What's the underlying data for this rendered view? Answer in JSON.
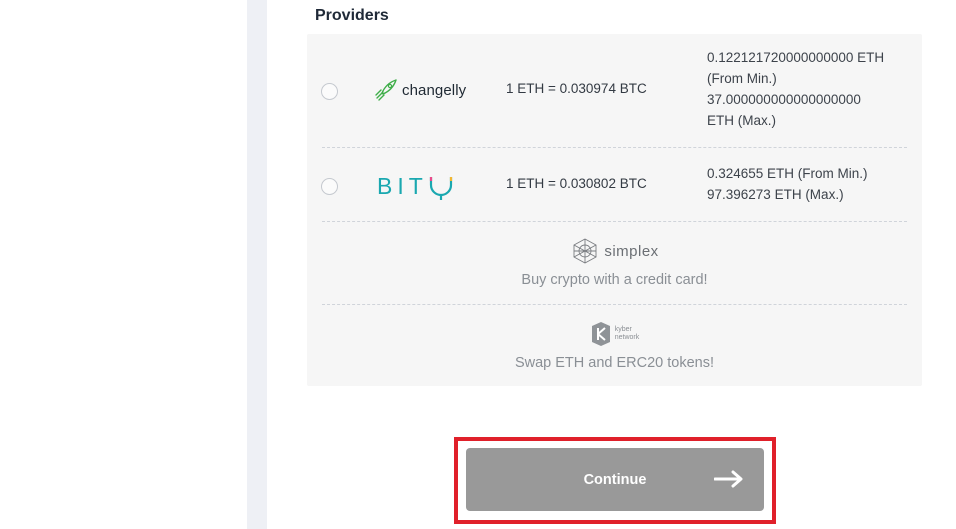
{
  "section_title": "Providers",
  "providers": [
    {
      "name": "changelly",
      "rate": "1 ETH = 0.030974 BTC",
      "limits": [
        "0.122121720000000000 ETH",
        "(From Min.)",
        "37.000000000000000000",
        "ETH (Max.)"
      ]
    },
    {
      "name": "BITY",
      "rate": "1 ETH = 0.030802 BTC",
      "limits": [
        "0.324655 ETH (From Min.)",
        "97.396273 ETH (Max.)"
      ]
    }
  ],
  "simplex": {
    "name": "simplex",
    "caption": "Buy crypto with a credit card!"
  },
  "kyber": {
    "name_line1": "kyber",
    "name_line2": "network",
    "caption": "Swap ETH and ERC20 tokens!"
  },
  "continue_button": {
    "label": "Continue"
  },
  "colors": {
    "accent_bity": "#1aa8b0",
    "changelly_green": "#3fae49",
    "button_disabled": "#999999",
    "highlight": "#e0202a"
  }
}
